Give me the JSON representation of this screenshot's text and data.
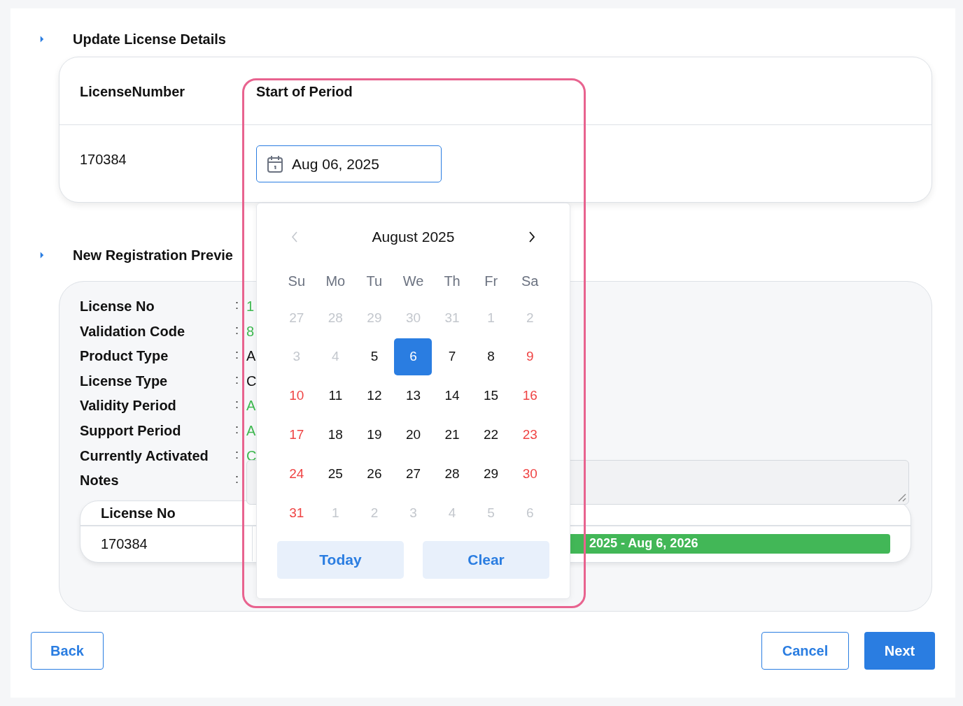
{
  "sections": [
    {
      "title": "Update License Details",
      "expanded": false
    },
    {
      "title": "New Registration Previe",
      "expanded": false
    }
  ],
  "update_table": {
    "columns": [
      "LicenseNumber",
      "Start of Period"
    ],
    "license_number": "170384",
    "start_date": {
      "value": "Aug 06, 2025"
    }
  },
  "preview": {
    "rows": [
      {
        "label": "License No",
        "value": "1",
        "color": "#3fb950"
      },
      {
        "label": "Validation Code",
        "value": "8",
        "color": "#3fb950"
      },
      {
        "label": "Product Type",
        "value": "A",
        "color": "#111111"
      },
      {
        "label": "License Type",
        "value": "C",
        "color": "#111111"
      },
      {
        "label": "Validity Period",
        "value": "A",
        "color": "#3fb950"
      },
      {
        "label": "Support Period",
        "value": "A",
        "color": "#3fb950"
      },
      {
        "label": "Currently Activated",
        "value": "C",
        "color": "#3fb950"
      },
      {
        "label": "Notes",
        "kind": "notes"
      }
    ],
    "separator": ":",
    "table": {
      "columns": [
        "License No"
      ],
      "rows": [
        {
          "license_no": "170384",
          "period": "2025 - Aug 6, 2026"
        }
      ]
    }
  },
  "calendar": {
    "month": "August 2025",
    "weekdays": [
      "Su",
      "Mo",
      "Tu",
      "We",
      "Th",
      "Fr",
      "Sa"
    ],
    "weeks": [
      [
        {
          "day": "27",
          "kind": "muted",
          "selected": false
        },
        {
          "day": "28",
          "kind": "muted",
          "selected": false
        },
        {
          "day": "29",
          "kind": "muted",
          "selected": false
        },
        {
          "day": "30",
          "kind": "muted",
          "selected": false
        },
        {
          "day": "31",
          "kind": "muted",
          "selected": false
        },
        {
          "day": "1",
          "kind": "muted",
          "selected": false
        },
        {
          "day": "2",
          "kind": "muted",
          "selected": false
        }
      ],
      [
        {
          "day": "3",
          "kind": "muted",
          "selected": false
        },
        {
          "day": "4",
          "kind": "muted",
          "selected": false
        },
        {
          "day": "5",
          "kind": "normal",
          "selected": false
        },
        {
          "day": "6",
          "kind": "normal",
          "selected": true
        },
        {
          "day": "7",
          "kind": "normal",
          "selected": false
        },
        {
          "day": "8",
          "kind": "normal",
          "selected": false
        },
        {
          "day": "9",
          "kind": "weekend",
          "selected": false
        }
      ],
      [
        {
          "day": "10",
          "kind": "weekend",
          "selected": false
        },
        {
          "day": "11",
          "kind": "normal",
          "selected": false
        },
        {
          "day": "12",
          "kind": "normal",
          "selected": false
        },
        {
          "day": "13",
          "kind": "normal",
          "selected": false
        },
        {
          "day": "14",
          "kind": "normal",
          "selected": false
        },
        {
          "day": "15",
          "kind": "normal",
          "selected": false
        },
        {
          "day": "16",
          "kind": "weekend",
          "selected": false
        }
      ],
      [
        {
          "day": "17",
          "kind": "weekend",
          "selected": false
        },
        {
          "day": "18",
          "kind": "normal",
          "selected": false
        },
        {
          "day": "19",
          "kind": "normal",
          "selected": false
        },
        {
          "day": "20",
          "kind": "normal",
          "selected": false
        },
        {
          "day": "21",
          "kind": "normal",
          "selected": false
        },
        {
          "day": "22",
          "kind": "normal",
          "selected": false
        },
        {
          "day": "23",
          "kind": "weekend",
          "selected": false
        }
      ],
      [
        {
          "day": "24",
          "kind": "weekend",
          "selected": false
        },
        {
          "day": "25",
          "kind": "normal",
          "selected": false
        },
        {
          "day": "26",
          "kind": "normal",
          "selected": false
        },
        {
          "day": "27",
          "kind": "normal",
          "selected": false
        },
        {
          "day": "28",
          "kind": "normal",
          "selected": false
        },
        {
          "day": "29",
          "kind": "normal",
          "selected": false
        },
        {
          "day": "30",
          "kind": "weekend",
          "selected": false
        }
      ],
      [
        {
          "day": "31",
          "kind": "weekend",
          "selected": false
        },
        {
          "day": "1",
          "kind": "muted",
          "selected": false
        },
        {
          "day": "2",
          "kind": "muted",
          "selected": false
        },
        {
          "day": "3",
          "kind": "muted",
          "selected": false
        },
        {
          "day": "4",
          "kind": "muted",
          "selected": false
        },
        {
          "day": "5",
          "kind": "muted",
          "selected": false
        },
        {
          "day": "6",
          "kind": "muted",
          "selected": false
        }
      ]
    ],
    "prev_disabled": true,
    "buttons": [
      "Today",
      "Clear"
    ]
  },
  "footer": {
    "back": "Back",
    "cancel": "Cancel",
    "next": "Next"
  }
}
